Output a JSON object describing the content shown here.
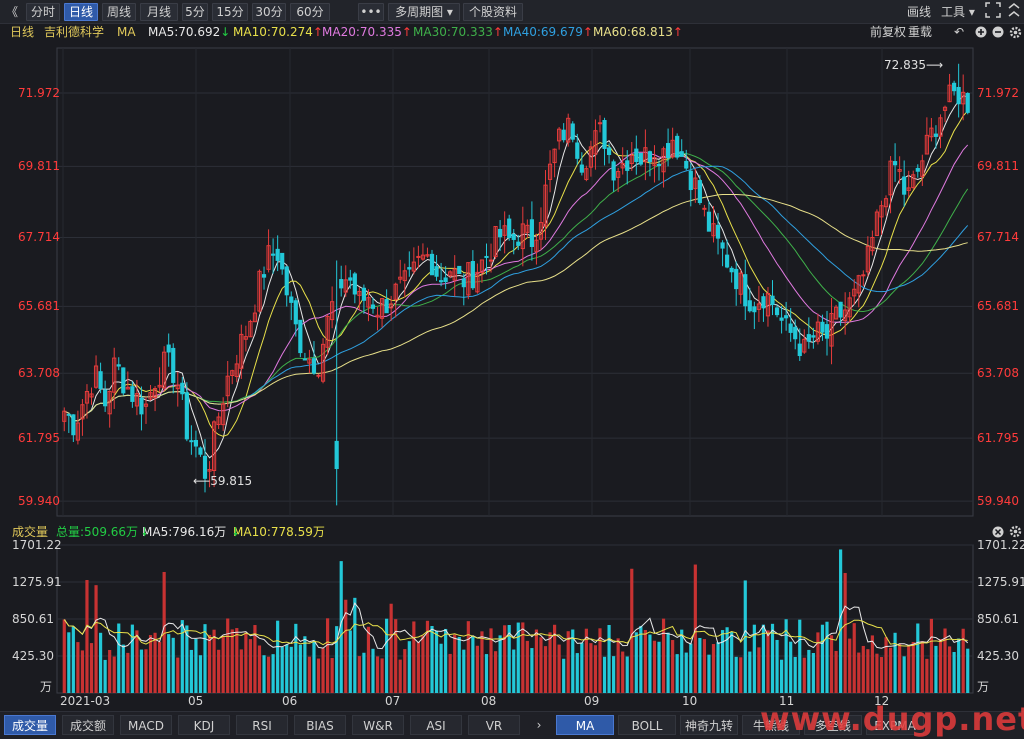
{
  "toolbar": {
    "back_icon": "double-chevron-left-icon",
    "back_glyph": "《",
    "periods": [
      "分时",
      "日线",
      "周线",
      "月线",
      "5分",
      "15分",
      "30分",
      "60分"
    ],
    "active_period": "日线",
    "more_label": "•••",
    "multi_period_label": "多周期图",
    "stock_info_label": "个股资料",
    "draw_label": "画线",
    "tools_label": "工具",
    "expand_icon": "fullscreen-icon"
  },
  "ma_legend": {
    "period_label": "日线",
    "stock_name": "吉利德科学",
    "ma_label": "MA",
    "items": [
      {
        "name": "MA5",
        "value": "70.692",
        "dir": "down",
        "color": "#e8e8e8"
      },
      {
        "name": "MA10",
        "value": "70.274",
        "dir": "up",
        "color": "#e8e04a"
      },
      {
        "name": "MA20",
        "value": "70.335",
        "dir": "up",
        "color": "#e07ae0"
      },
      {
        "name": "MA30",
        "value": "70.333",
        "dir": "up",
        "color": "#3fb04a"
      },
      {
        "name": "MA40",
        "value": "69.679",
        "dir": "up",
        "color": "#2fa0e0"
      },
      {
        "name": "MA60",
        "value": "68.813",
        "dir": "up",
        "color": "#e8e08a"
      }
    ],
    "fq_label": "前复权",
    "reload_label": "重载"
  },
  "price_axis": {
    "ticks": [
      "71.972",
      "69.811",
      "67.714",
      "65.681",
      "63.708",
      "61.795",
      "59.940"
    ],
    "high_label": "72.835",
    "low_label": "59.815"
  },
  "volume": {
    "title": "成交量",
    "total_label": "总量:509.66万",
    "ma5_label": "MA5:796.16万",
    "ma10_label": "MA10:778.59万",
    "ticks": [
      "1701.22",
      "1275.91",
      "850.61",
      "425.30",
      "万"
    ]
  },
  "time_axis": [
    "2021-03",
    "05",
    "06",
    "07",
    "08",
    "09",
    "10",
    "11",
    "12"
  ],
  "bottom_tabs": {
    "left": [
      "成交量",
      "成交额",
      "MACD",
      "KDJ",
      "RSI",
      "BIAS",
      "W&R",
      "ASI",
      "VR"
    ],
    "right": [
      "MA",
      "BOLL",
      "神奇九转",
      "牛熊线",
      "多空线",
      "EXPMA"
    ],
    "active_left": "成交量",
    "active_right": "MA"
  },
  "watermark": "www.dugp.net",
  "chart_data": {
    "type": "candlestick",
    "price_range": [
      59.5,
      73.3
    ],
    "months": [
      "2021-03",
      "05",
      "06",
      "07",
      "08",
      "09",
      "10",
      "11",
      "12"
    ],
    "ma_lines": [
      {
        "name": "MA5",
        "color": "#e8e8e8",
        "last": 70.692
      },
      {
        "name": "MA10",
        "color": "#e8e04a",
        "last": 70.274
      },
      {
        "name": "MA20",
        "color": "#e07ae0",
        "last": 70.335
      },
      {
        "name": "MA30",
        "color": "#3fb04a",
        "last": 70.333
      },
      {
        "name": "MA40",
        "color": "#2fa0e0",
        "last": 69.679
      },
      {
        "name": "MA60",
        "color": "#e8e08a",
        "last": 68.813
      }
    ],
    "close_path": [
      62.6,
      62.2,
      63.0,
      63.7,
      62.8,
      64.0,
      63.4,
      63.0,
      62.7,
      63.6,
      64.0,
      63.7,
      62.1,
      61.5,
      60.7,
      62.2,
      63.5,
      64.3,
      65.0,
      66.1,
      67.1,
      67.3,
      66.0,
      64.8,
      64.2,
      64.0,
      65.3,
      66.3,
      66.6,
      65.8,
      66.0,
      65.6,
      65.9,
      66.2,
      66.4,
      67.0,
      67.2,
      66.5,
      66.8,
      66.4,
      66.6,
      66.9,
      67.4,
      67.8,
      67.6,
      67.9,
      67.6,
      68.5,
      69.9,
      70.8,
      71.0,
      70.0,
      70.4,
      70.9,
      69.8,
      69.9,
      70.3,
      70.0,
      70.4,
      70.2,
      70.7,
      70.0,
      69.4,
      68.4,
      67.7,
      67.2,
      66.7,
      66.1,
      65.8,
      66.1,
      65.7,
      65.0,
      64.8,
      64.3,
      64.9,
      64.7,
      65.3,
      65.6,
      66.0,
      66.8,
      68.1,
      69.3,
      69.9,
      68.8,
      69.6,
      70.4,
      71.2,
      71.7,
      72.0,
      71.7
    ],
    "volume_range": [
      0,
      1701.22
    ],
    "volume_ma5_last": 796.16,
    "volume_ma10_last": 778.59,
    "volume_last": 509.66
  }
}
